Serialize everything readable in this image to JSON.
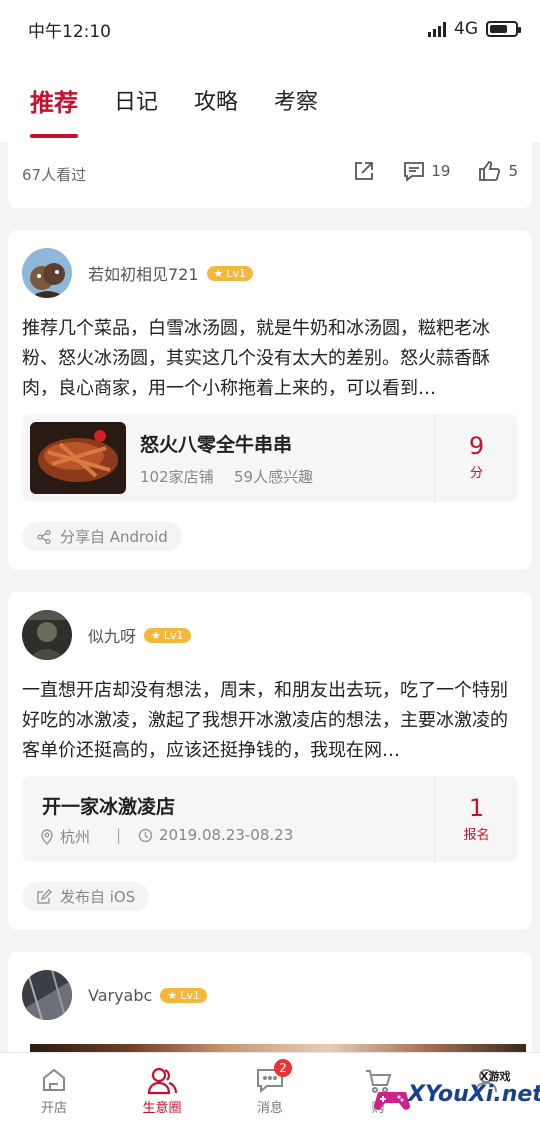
{
  "status_bar": {
    "time": "中午12:10",
    "network": "4G"
  },
  "tabs": [
    "推荐",
    "日记",
    "攻略",
    "考察"
  ],
  "card1": {
    "views": "67人看过",
    "comments": "19",
    "likes": "5"
  },
  "post1": {
    "author": "若如初相见721",
    "level": "Lv1",
    "text": "推荐几个菜品，白雪冰汤圆，就是牛奶和冰汤圆，糍粑老冰粉、怒火冰汤圆，其实这几个没有太大的差别。怒火蒜香酥肉，良心商家，用一个小称拖着上来的，可以看到…",
    "embed": {
      "name": "怒火八零全牛串串",
      "stores": "102家店铺",
      "interest": "59人感兴趣",
      "score": "9",
      "score_unit": "分"
    },
    "source": "分享自 Android"
  },
  "post2": {
    "author": "似九呀",
    "level": "Lv1",
    "text": "一直想开店却没有想法，周末，和朋友出去玩，吃了一个特别好吃的冰激凌，激起了我想开冰激凌店的想法，主要冰激凌的客单价还挺高的，应该还挺挣钱的，我现在网…",
    "embed": {
      "name": "开一家冰激凌店",
      "city": "杭州",
      "separator": "|",
      "date": "2019.08.23-08.23",
      "count": "1",
      "count_unit": "报名"
    },
    "source": "发布自 iOS"
  },
  "post3": {
    "author": "Varyabc",
    "level": "Lv1"
  },
  "bottom_nav": [
    {
      "label": "开店",
      "icon": "home-icon"
    },
    {
      "label": "生意圈",
      "icon": "community-icon"
    },
    {
      "label": "消息",
      "icon": "message-icon",
      "badge": "2"
    },
    {
      "label": "购",
      "icon": "cart-icon"
    },
    {
      "label": "",
      "icon": "profile-icon"
    }
  ],
  "watermark": {
    "text": "XYouXi.net",
    "small": "X游戏"
  },
  "colors": {
    "accent": "#c8102e",
    "level_badge": "#f3b73c"
  }
}
